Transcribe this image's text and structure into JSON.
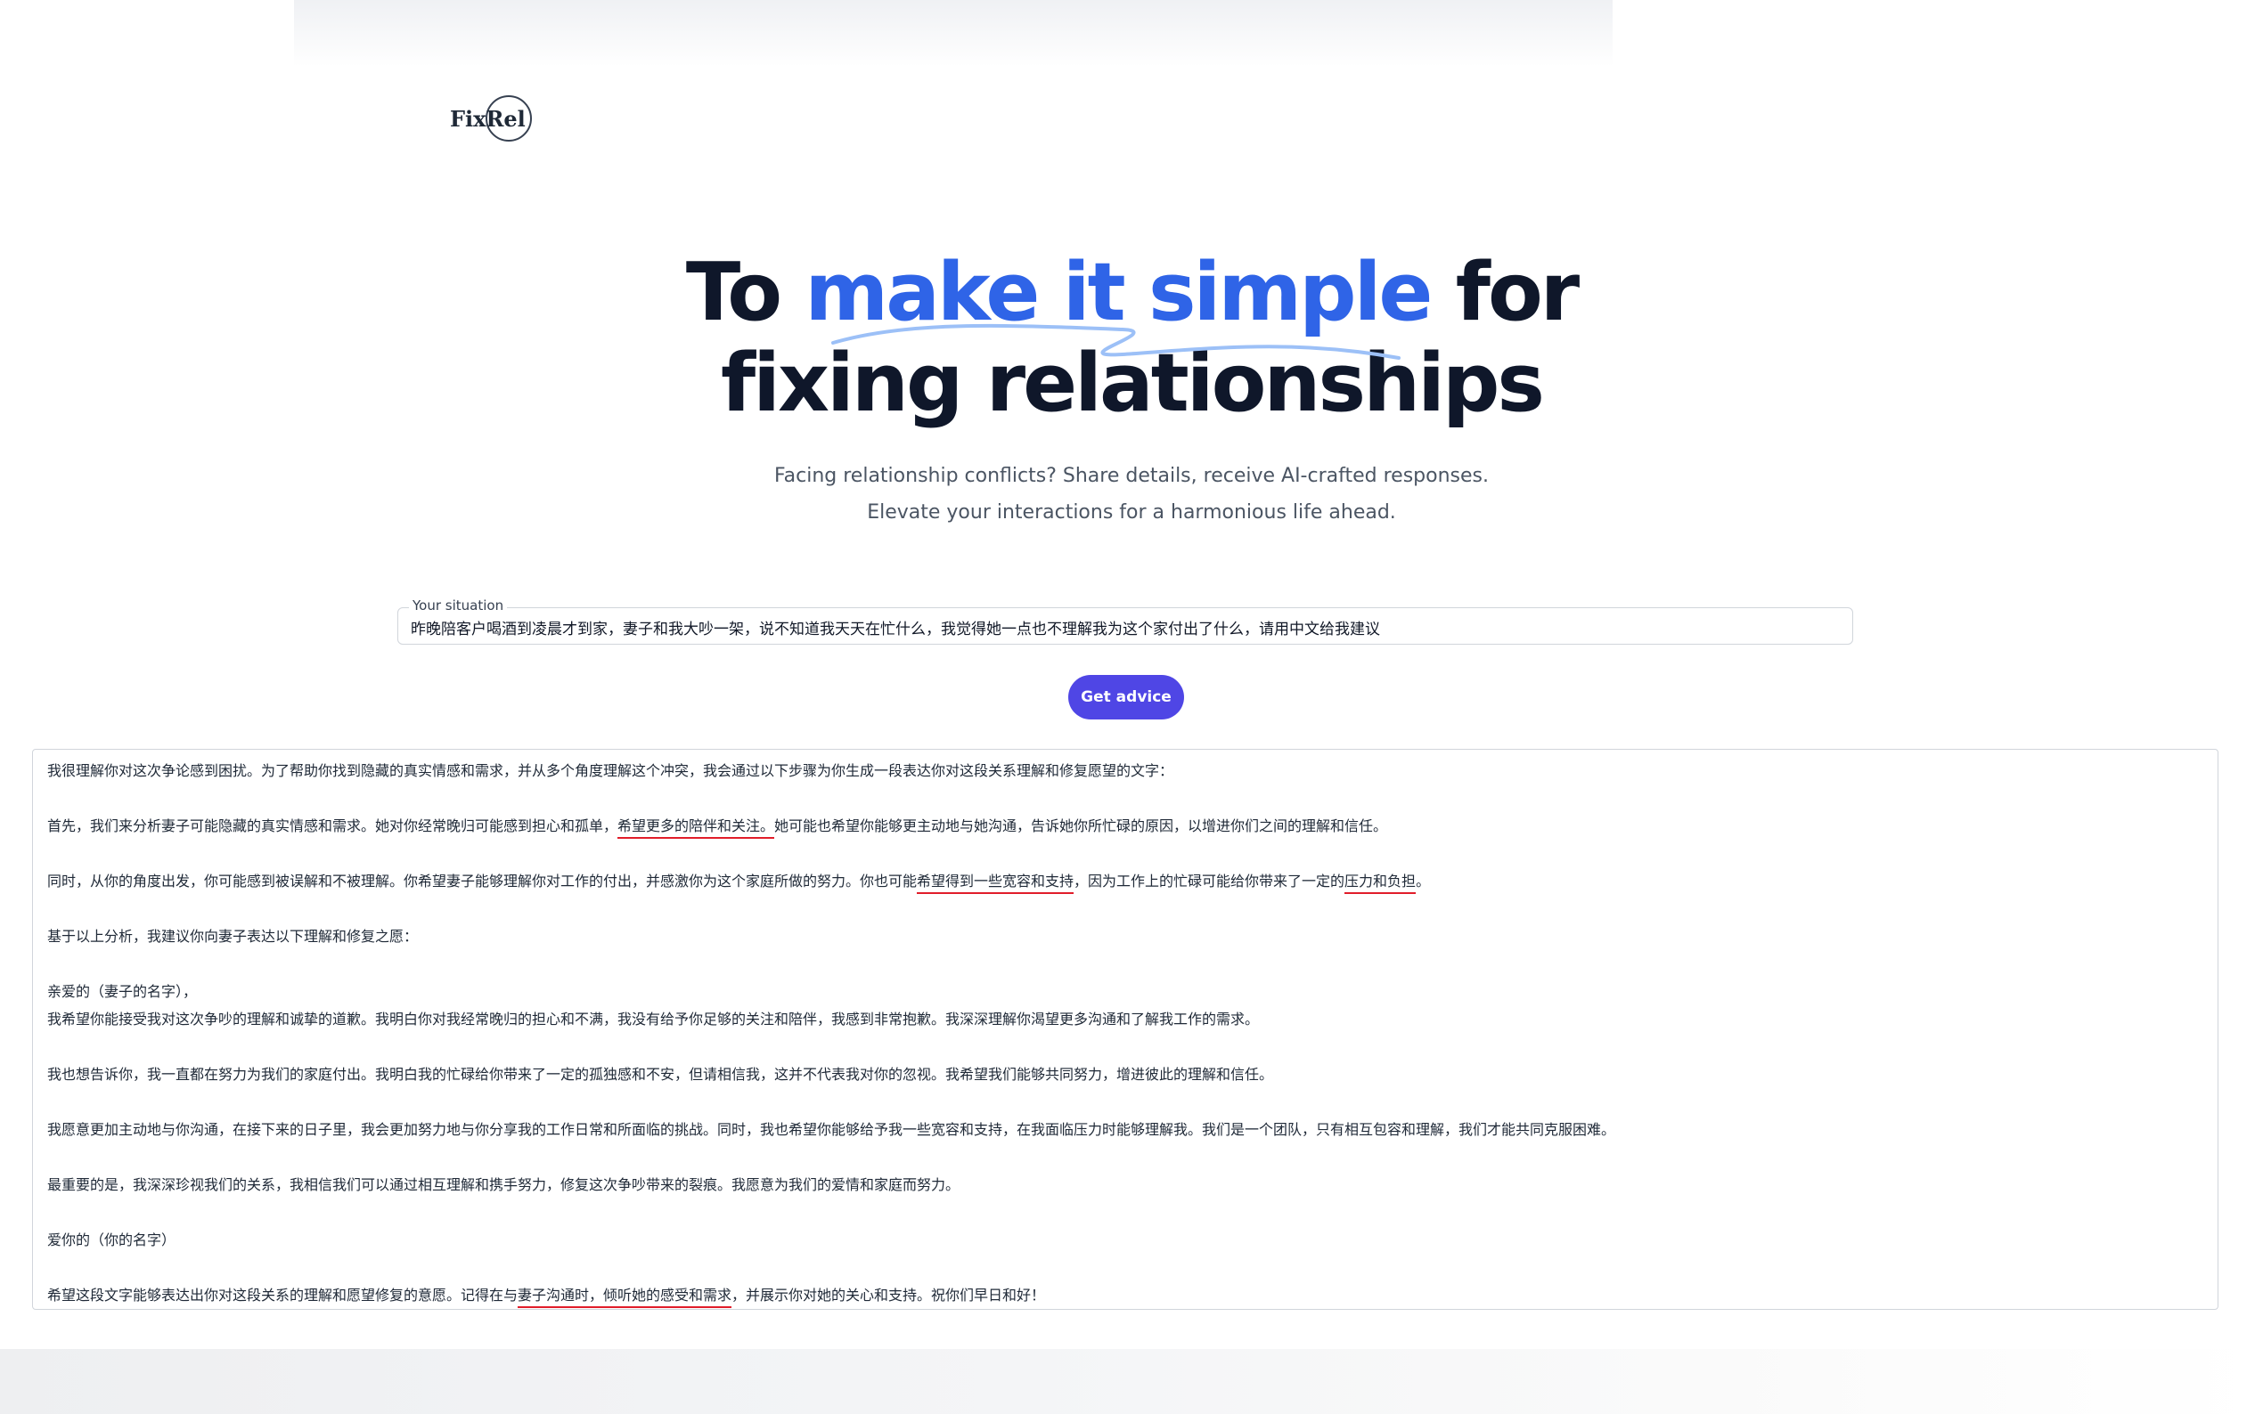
{
  "brand": {
    "logo_text": "FixRel"
  },
  "hero": {
    "prefix": "To ",
    "accent": "make it simple",
    "suffix": " for",
    "line2": "fixing relationships"
  },
  "subtitle": {
    "line1": "Facing relationship conflicts? Share details, receive AI-crafted responses.",
    "line2": "Elevate your interactions for a harmonious life ahead."
  },
  "situation": {
    "label": "Your situation",
    "value_main": "昨晚陪客户喝酒到凌晨才到家，妻子和我大吵一架，说不知道我天天在忙什么，我觉得她一点也不理解我为这个家付出了什么，",
    "value_highlight": "请用中文给我建议"
  },
  "actions": {
    "get_advice": "Get advice"
  },
  "colors": {
    "accent": "#2f64e7",
    "button": "#4f46e5",
    "annotation": "#e11d2a"
  },
  "response": {
    "p1": "我很理解你对这次争论感到困扰。为了帮助你找到隐藏的真实情感和需求，并从多个角度理解这个冲突，我会通过以下步骤为你生成一段表达你对这段关系理解和修复愿望的文字：",
    "p2_a": "首先，我们来分析妻子可能隐藏的真实情感和需求。她对你经常晚归可能感到担心和孤单，",
    "p2_b": "希望更多的陪伴和关注。",
    "p2_c": "她可能也希望你能够更主动地与她沟通，告诉她你所忙碌的原因，以增进你们之间的理解和信任。",
    "p3_a": "同时，从你的角度出发，你可能感到被误解和不被理解。你希望妻子能够理解你对工作的付出，并感激你为这个家庭所做的努力。你也可能",
    "p3_b": "希望得到一些宽容和支持",
    "p3_c": "，因为工作上的忙碌可能给你带来了一定的",
    "p3_d": "压力和负担",
    "p3_e": "。",
    "p4": "基于以上分析，我建议你向妻子表达以下理解和修复之愿：",
    "p5": "亲爱的（妻子的名字），",
    "p6": "我希望你能接受我对这次争吵的理解和诚挚的道歉。我明白你对我经常晚归的担心和不满，我没有给予你足够的关注和陪伴，我感到非常抱歉。我深深理解你渴望更多沟通和了解我工作的需求。",
    "p7": "我也想告诉你，我一直都在努力为我们的家庭付出。我明白我的忙碌给你带来了一定的孤独感和不安，但请相信我，这并不代表我对你的忽视。我希望我们能够共同努力，增进彼此的理解和信任。",
    "p8": "我愿意更加主动地与你沟通，在接下来的日子里，我会更加努力地与你分享我的工作日常和所面临的挑战。同时，我也希望你能够给予我一些宽容和支持，在我面临压力时能够理解我。我们是一个团队，只有相互包容和理解，我们才能共同克服困难。",
    "p9": "最重要的是，我深深珍视我们的关系，我相信我们可以通过相互理解和携手努力，修复这次争吵带来的裂痕。我愿意为我们的爱情和家庭而努力。",
    "p10": "爱你的（你的名字）",
    "p11_a": "希望这段文字能够表达出你对这段关系的理解和愿望修复的意愿。记得在与",
    "p11_b": "妻子沟通时，倾听她的感受和需求",
    "p11_c": "，并展示你对她的关心和支持。祝你们早日和好！"
  }
}
